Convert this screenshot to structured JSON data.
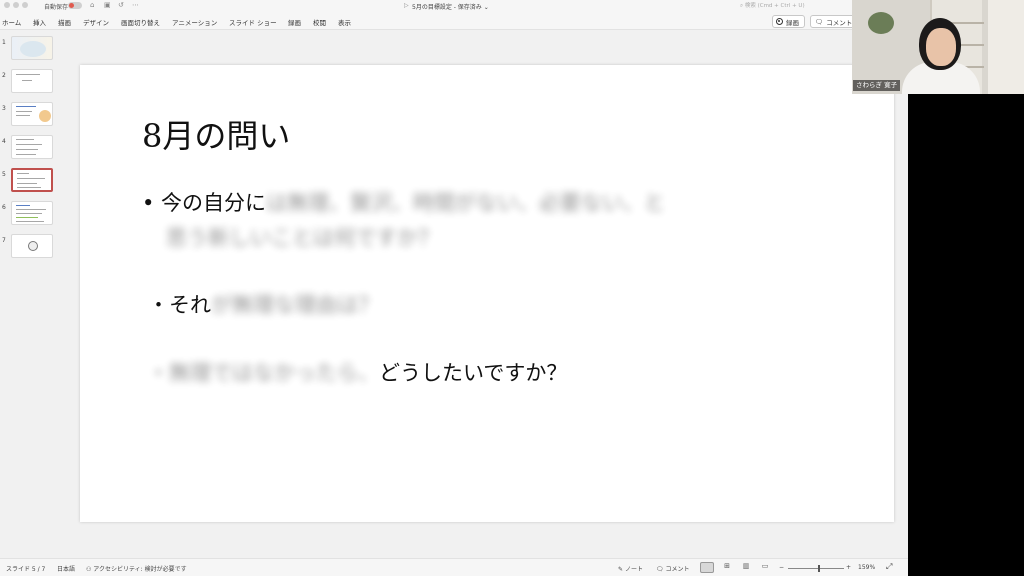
{
  "titlebar": {
    "autosave_label": "自動保存",
    "doc_title": "5月の目標設定 - 保存済み ⌄",
    "search_placeholder": "検索 (Cmd + Ctrl + U)"
  },
  "ribbon": {
    "tabs": [
      "ホーム",
      "挿入",
      "描画",
      "デザイン",
      "画面切り替え",
      "アニメーション",
      "スライド ショー",
      "録画",
      "校閲",
      "表示"
    ],
    "record_label": "録画",
    "comment_label": "コメント"
  },
  "thumbnails": {
    "numbers": [
      "1",
      "2",
      "3",
      "4",
      "5",
      "6",
      "7"
    ],
    "selected_index": 5
  },
  "slide": {
    "title": "8月の問い",
    "line1_clear": "• 今の自分に",
    "line1_blur": "は無理、贅沢、時間がない、必要ない、と",
    "line2_blur": "思う新しいことは何ですか？",
    "line3_clear": "・それ",
    "line3_blur": "が無理な理由は？",
    "line4_blur": "・無理ではなかったら、",
    "line4_clear": "どうしたいですか？"
  },
  "statusbar": {
    "slide_counter": "スライド 5 / 7",
    "language": "日本語",
    "accessibility": "アクセシビリティ: 検討が必要です",
    "notes_label": "ノート",
    "comments_label": "コメント",
    "zoom_minus": "−",
    "zoom_plus": "+",
    "zoom_level": "159%"
  },
  "video": {
    "participant_name": "さわらぎ 寛子"
  },
  "colors": {
    "selected_thumb_border": "#c0504d",
    "autosave_toggle": "#e05a4e"
  }
}
